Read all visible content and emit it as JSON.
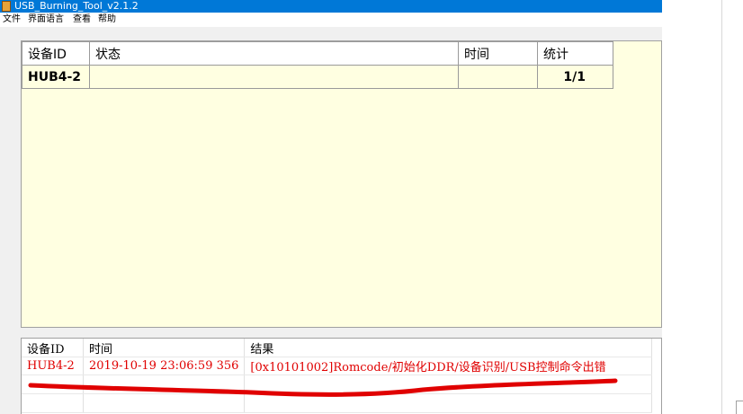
{
  "window": {
    "title": "USB_Burning_Tool_v2.1.2"
  },
  "menu": [
    {
      "label": "文件"
    },
    {
      "label": "界面语言"
    },
    {
      "label": "查看"
    },
    {
      "label": "帮助"
    }
  ],
  "device_table": {
    "headers": [
      "设备ID",
      "状态",
      "时间",
      "统计"
    ],
    "rows": [
      {
        "device_id": "HUB4-2",
        "status": "",
        "time": "",
        "stats": "1/1"
      }
    ]
  },
  "log_table": {
    "headers": [
      "设备ID",
      "时间",
      "结果"
    ],
    "rows": [
      {
        "device_id": "HUB4-2",
        "time": "2019-10-19 23:06:59 356",
        "result": "[0x10101002]Romcode/初始化DDR/设备识别/USB控制命令出错"
      }
    ]
  },
  "colors": {
    "titlebar": "#0078d7",
    "panel_background": "#ffffe1",
    "error_text": "#e00000",
    "annotation": "#e00000"
  }
}
